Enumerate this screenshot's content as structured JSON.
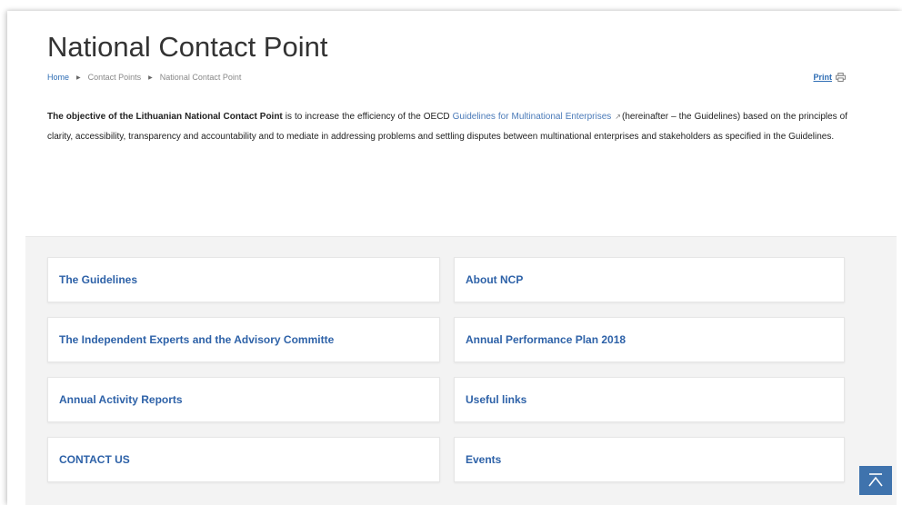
{
  "page": {
    "title": "National Contact Point"
  },
  "breadcrumb": {
    "items": [
      "Home",
      "Contact Points",
      "National Contact Point"
    ]
  },
  "print": {
    "label": "Print"
  },
  "intro": {
    "bold_lead": "The objective of the Lithuanian National Contact Point",
    "text_before_link": " is to increase the efficiency of the OECD ",
    "link_text": "Guidelines for Multinational Enterprises",
    "ext_icon": "external-link-icon",
    "text_after_link": "(hereinafter – the Guidelines) based on the principles of clarity, accessibility, transparency and accountability and to mediate in addressing problems and settling disputes between multinational enterprises and stakeholders as specified in the Guidelines."
  },
  "tiles": [
    {
      "label": "The Guidelines"
    },
    {
      "label": "About NCP"
    },
    {
      "label": "The Independent Experts and the Advisory Committe"
    },
    {
      "label": "Annual Performance Plan 2018"
    },
    {
      "label": "Annual Activity Reports"
    },
    {
      "label": "Useful links"
    },
    {
      "label": "CONTACT US"
    },
    {
      "label": "Events"
    }
  ],
  "colors": {
    "link_blue": "#2e62a8",
    "scroll_top_bg": "#3f73ad",
    "tiles_bg": "#f3f3f3"
  },
  "icons": {
    "print": "printer-icon",
    "scroll_top": "chevron-up-icon"
  }
}
